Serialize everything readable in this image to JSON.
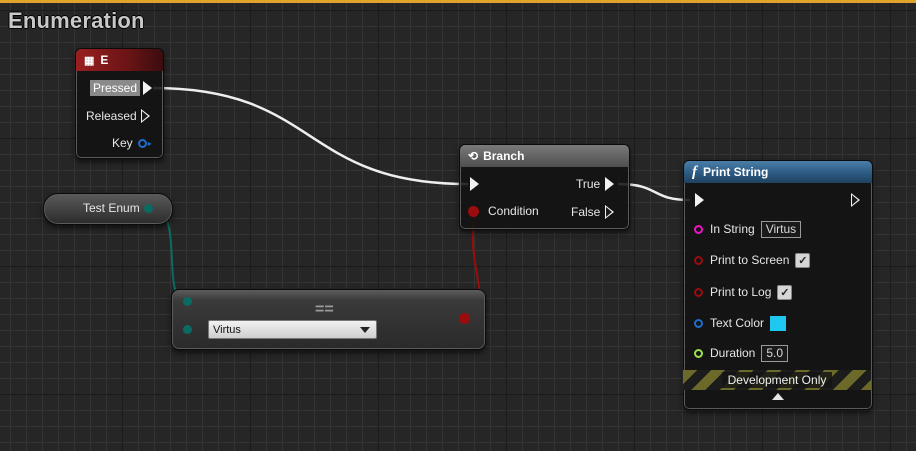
{
  "graph_title": "Enumeration",
  "colors": {
    "top_bar": "#e2a32a",
    "exec_pin": "#f2f2f2",
    "bool_pin": "#9b0d0d",
    "string_pin": "#f012c8",
    "struct_pin": "#1f6ecf",
    "float_pin": "#9ee24a",
    "enum_pin": "#0a6b63",
    "text_color_swatch": "#1ec8f0"
  },
  "key_event": {
    "title": "E",
    "icon": "keyboard-icon",
    "pins": {
      "pressed": "Pressed",
      "released": "Released",
      "key": "Key"
    }
  },
  "enum_variable": {
    "label": "Test Enum"
  },
  "equals_node": {
    "title": "==",
    "enum_value": "Virtus"
  },
  "branch": {
    "title": "Branch",
    "icon": "branch-icon",
    "pins": {
      "condition": "Condition",
      "true": "True",
      "false": "False"
    }
  },
  "print_string": {
    "title": "Print String",
    "icon": "function-icon",
    "fields": {
      "in_string_label": "In String",
      "in_string_value": "Virtus",
      "print_to_screen_label": "Print to Screen",
      "print_to_screen": true,
      "print_to_log_label": "Print to Log",
      "print_to_log": true,
      "text_color_label": "Text Color",
      "duration_label": "Duration",
      "duration_value": "5.0"
    },
    "footer": "Development Only"
  }
}
